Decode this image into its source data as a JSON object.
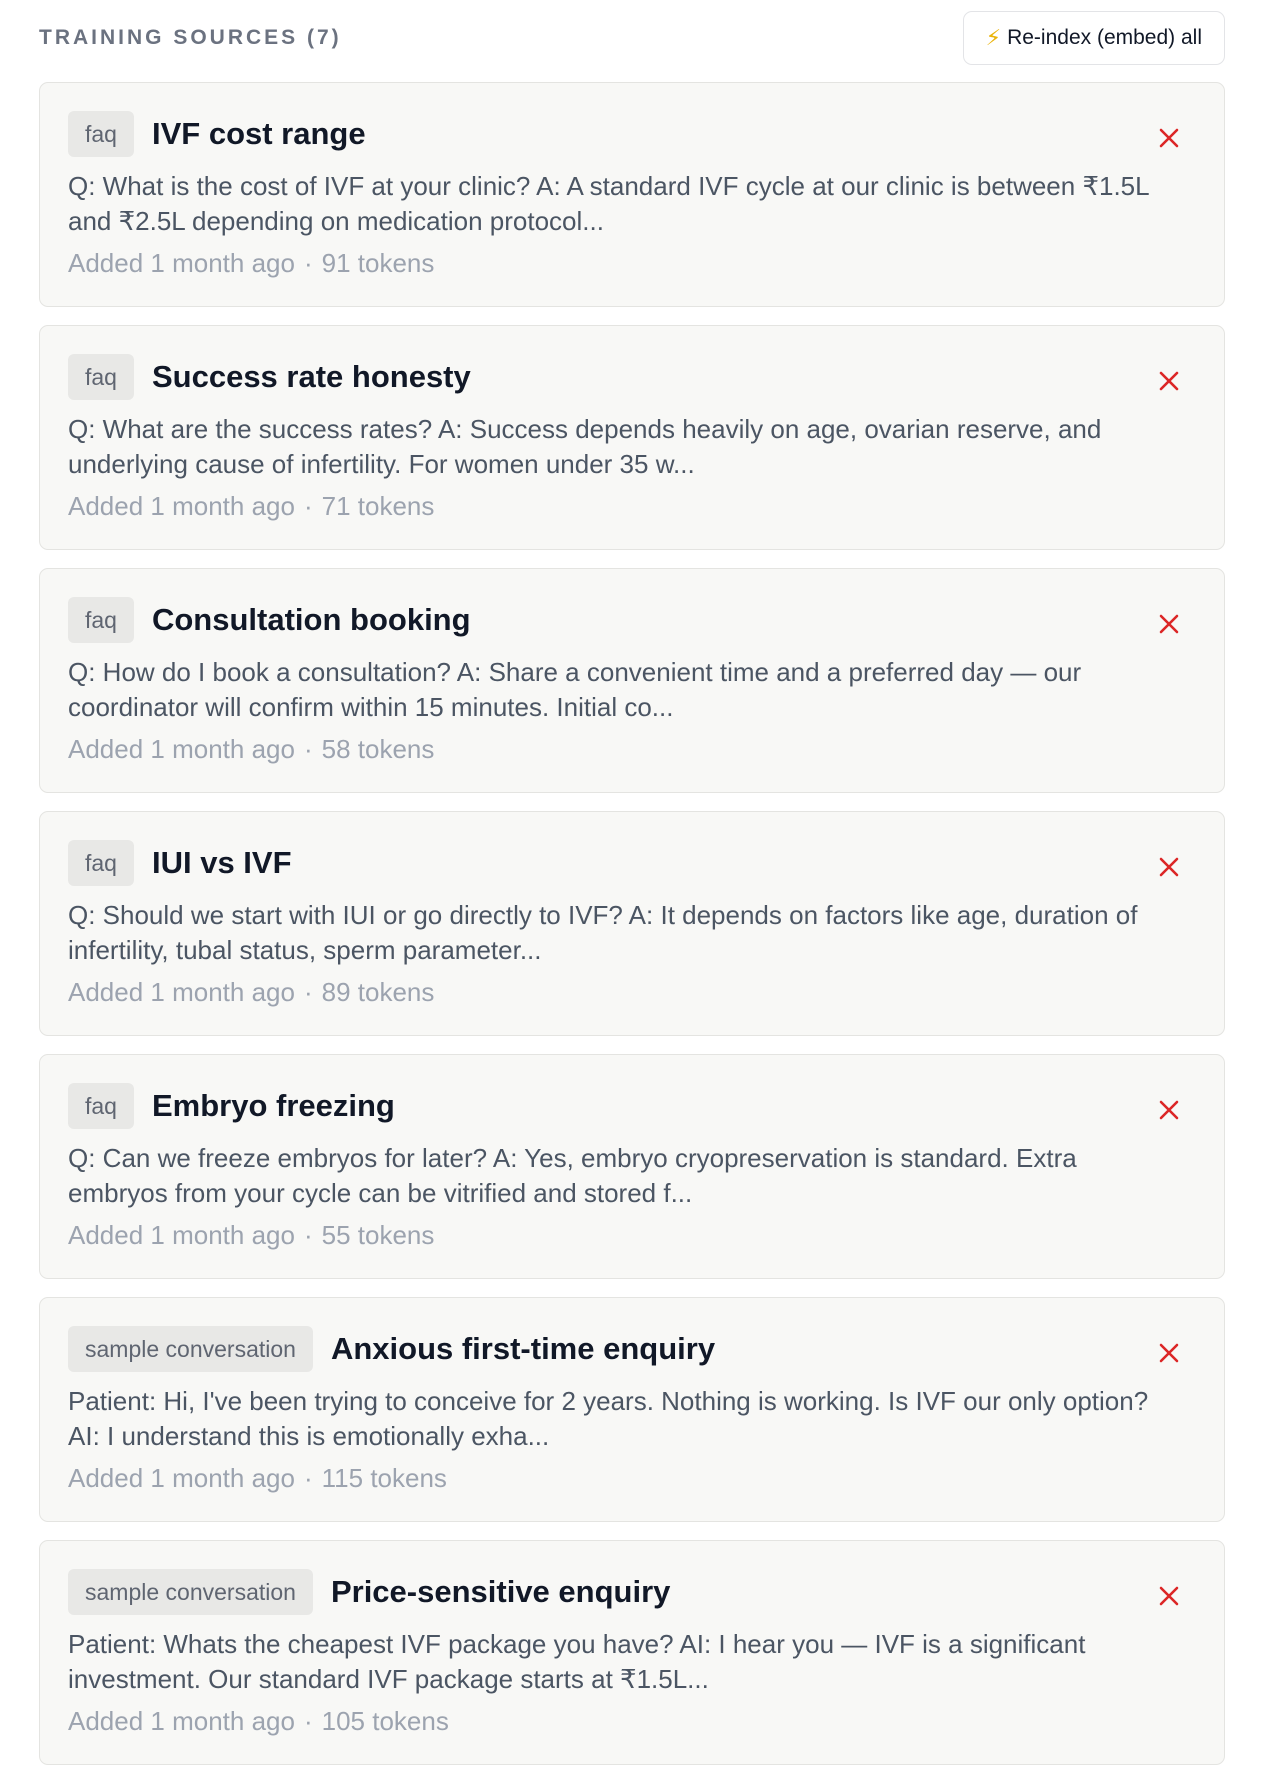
{
  "header": {
    "section_title": "TRAINING SOURCES (7)",
    "reindex_label": "Re-index (embed) all",
    "reindex_icon": "lightning-bolt-icon"
  },
  "colors": {
    "delete": "#dc2626",
    "bolt": "#eab308",
    "card_bg": "#f8f8f6"
  },
  "sources": [
    {
      "type": "faq",
      "title": "IVF cost range",
      "preview": "Q: What is the cost of IVF at your clinic? A: A standard IVF cycle at our clinic is between ₹1.5L and ₹2.5L depending on medication protocol...",
      "added": "Added 1 month ago",
      "separator": "·",
      "tokens": "91 tokens"
    },
    {
      "type": "faq",
      "title": "Success rate honesty",
      "preview": "Q: What are the success rates? A: Success depends heavily on age, ovarian reserve, and underlying cause of infertility. For women under 35 w...",
      "added": "Added 1 month ago",
      "separator": "·",
      "tokens": "71 tokens"
    },
    {
      "type": "faq",
      "title": "Consultation booking",
      "preview": "Q: How do I book a consultation? A: Share a convenient time and a preferred day — our coordinator will confirm within 15 minutes. Initial co...",
      "added": "Added 1 month ago",
      "separator": "·",
      "tokens": "58 tokens"
    },
    {
      "type": "faq",
      "title": "IUI vs IVF",
      "preview": "Q: Should we start with IUI or go directly to IVF? A: It depends on factors like age, duration of infertility, tubal status, sperm parameter...",
      "added": "Added 1 month ago",
      "separator": "·",
      "tokens": "89 tokens"
    },
    {
      "type": "faq",
      "title": "Embryo freezing",
      "preview": "Q: Can we freeze embryos for later? A: Yes, embryo cryopreservation is standard. Extra embryos from your cycle can be vitrified and stored f...",
      "added": "Added 1 month ago",
      "separator": "·",
      "tokens": "55 tokens"
    },
    {
      "type": "sample conversation",
      "title": "Anxious first-time enquiry",
      "preview": "Patient: Hi, I've been trying to conceive for 2 years. Nothing is working. Is IVF our only option? AI: I understand this is emotionally exha...",
      "added": "Added 1 month ago",
      "separator": "·",
      "tokens": "115 tokens"
    },
    {
      "type": "sample conversation",
      "title": "Price-sensitive enquiry",
      "preview": "Patient: Whats the cheapest IVF package you have? AI: I hear you — IVF is a significant investment. Our standard IVF package starts at ₹1.5L...",
      "added": "Added 1 month ago",
      "separator": "·",
      "tokens": "105 tokens"
    }
  ]
}
